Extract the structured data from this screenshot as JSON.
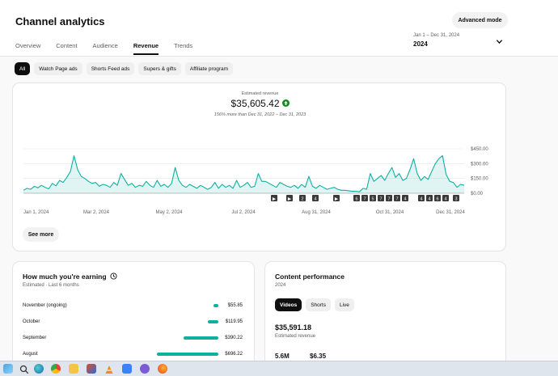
{
  "header": {
    "title": "Channel analytics",
    "advanced_label": "Advanced mode",
    "tabs": [
      {
        "label": "Overview",
        "active": false
      },
      {
        "label": "Content",
        "active": false
      },
      {
        "label": "Audience",
        "active": false
      },
      {
        "label": "Revenue",
        "active": true
      },
      {
        "label": "Trends",
        "active": false
      }
    ],
    "date_range": "Jan 1 – Dec 31, 2024",
    "year": "2024"
  },
  "filter_chips": [
    {
      "label": "All",
      "active": true
    },
    {
      "label": "Watch Page ads",
      "active": false
    },
    {
      "label": "Shorts Feed ads",
      "active": false
    },
    {
      "label": "Supers & gifts",
      "active": false
    },
    {
      "label": "Affiliate program",
      "active": false
    }
  ],
  "revenue": {
    "label": "Estimated revenue",
    "value": "$35,605.42",
    "comparison": "156% more than Dec 31, 2022 – Dec 31, 2023",
    "see_more": "See more",
    "accent_color": "#0fb0a0"
  },
  "chart_data": {
    "type": "area",
    "y_ticks": [
      "$450.00",
      "$300.00",
      "$150.00",
      "$0.00"
    ],
    "x_ticks": [
      "Jan 1, 2024",
      "Mar 2, 2024",
      "May 2, 2024",
      "Jul 2, 2024",
      "Aug 31, 2024",
      "Oct 31, 2024",
      "Dec 31, 2024"
    ],
    "ylim": [
      0,
      450
    ],
    "grid": true,
    "markers": [
      "▶",
      "▶",
      "2",
      "4",
      "▶",
      "6",
      "7",
      "5",
      "7",
      "7",
      "7",
      "4",
      "4",
      "4",
      "6",
      "4",
      "3"
    ],
    "x": [
      0,
      3,
      6,
      9,
      12,
      15,
      18,
      21,
      24,
      27,
      30,
      33,
      36,
      39,
      42,
      45,
      48,
      51,
      54,
      57,
      60,
      63,
      66,
      69,
      72,
      75,
      78,
      81,
      84,
      87,
      90,
      93,
      96,
      99,
      102,
      105,
      108,
      111,
      114,
      117,
      120,
      123,
      126,
      129,
      132,
      135,
      138,
      141,
      144,
      147,
      150,
      153,
      156,
      159,
      162,
      165,
      168,
      171,
      174,
      177,
      180,
      183,
      186,
      189,
      192,
      195,
      198,
      201,
      204,
      207,
      210,
      213,
      216,
      219,
      222,
      225,
      228,
      231,
      234,
      237,
      240,
      243,
      246,
      249,
      252,
      255,
      258,
      261,
      264,
      267,
      270,
      273,
      276,
      279,
      282,
      285,
      288,
      291,
      294,
      297,
      300,
      303,
      306,
      309,
      312,
      315,
      318,
      321,
      324,
      327,
      330,
      333,
      336,
      339,
      342,
      345,
      348,
      351,
      354,
      357,
      360,
      363,
      366
    ],
    "values": [
      30,
      50,
      40,
      70,
      55,
      80,
      60,
      45,
      100,
      75,
      130,
      110,
      160,
      220,
      380,
      240,
      170,
      150,
      120,
      100,
      110,
      70,
      90,
      80,
      60,
      110,
      80,
      200,
      140,
      80,
      100,
      60,
      80,
      70,
      120,
      80,
      60,
      130,
      70,
      90,
      60,
      100,
      260,
      130,
      80,
      60,
      90,
      70,
      50,
      80,
      60,
      40,
      60,
      110,
      50,
      90,
      60,
      80,
      50,
      130,
      60,
      80,
      110,
      60,
      70,
      200,
      120,
      120,
      100,
      80,
      60,
      110,
      90,
      70,
      60,
      80,
      50,
      90,
      60,
      170,
      70,
      50,
      80,
      60,
      40,
      50,
      60,
      40,
      30,
      30,
      25,
      20,
      20,
      15,
      50,
      40,
      200,
      120,
      150,
      180,
      130,
      200,
      260,
      160,
      200,
      130,
      150,
      240,
      350,
      200,
      130,
      170,
      140,
      220,
      300,
      350,
      380,
      190,
      120,
      110,
      60,
      90,
      80
    ]
  },
  "earning": {
    "title": "How much you're earning",
    "subtitle": "Estimated · Last 6 months",
    "rows": [
      {
        "month": "November (ongoing)",
        "value": "$55.85",
        "amount": 55.85
      },
      {
        "month": "October",
        "value": "$119.95",
        "amount": 119.95
      },
      {
        "month": "September",
        "value": "$390.22",
        "amount": 390.22
      },
      {
        "month": "August",
        "value": "$696.22",
        "amount": 696.22
      }
    ]
  },
  "performance": {
    "title": "Content performance",
    "subtitle": "2024",
    "chips": [
      {
        "label": "Videos",
        "active": true
      },
      {
        "label": "Shorts",
        "active": false
      },
      {
        "label": "Live",
        "active": false
      }
    ],
    "value": "$35,591.18",
    "value_label": "Estimated revenue",
    "metric1": "5.6M",
    "metric2": "$6.35"
  },
  "taskbar": {
    "icons": [
      "windows-explorer",
      "search",
      "edge",
      "chrome",
      "file-explorer",
      "office",
      "vlc",
      "store",
      "chat",
      "firefox"
    ]
  }
}
